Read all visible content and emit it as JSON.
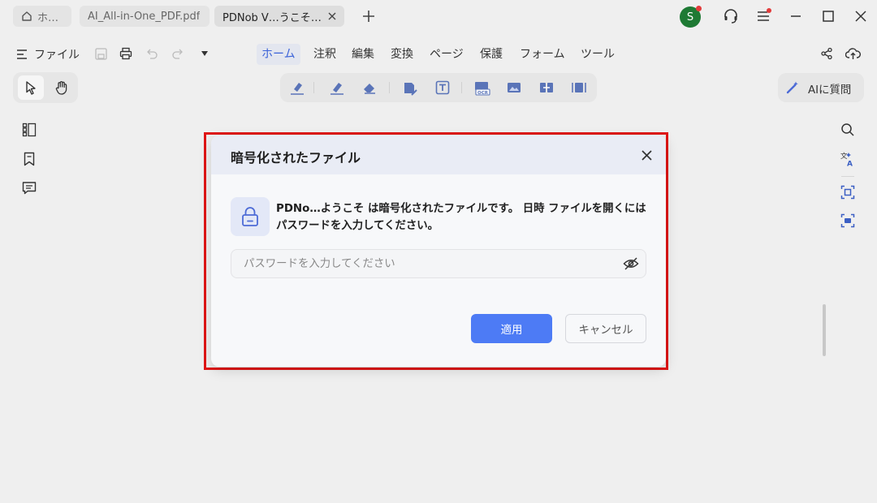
{
  "tabs": [
    {
      "label": "ホーム",
      "icon": "home-icon"
    },
    {
      "label": "AI_All-in-One_PDF.pdf"
    },
    {
      "label": "PDNob V…うこそ.pdf",
      "active": true
    }
  ],
  "new_tab_icon": "plus-icon",
  "window": {
    "avatar_letter": "S",
    "avatar_color": "#1e7a34",
    "notify_color": "#e23b3b"
  },
  "menu": {
    "file_label": "ファイル",
    "items": [
      "ホーム",
      "注釈",
      "編集",
      "変換",
      "ページ",
      "保護",
      "フォーム",
      "ツール"
    ],
    "active_index": 0
  },
  "toolbar": {
    "ai_label": "AIに質問"
  },
  "dialog": {
    "title": "暗号化されたファイル",
    "message": "PDNo…ようこそ は暗号化されたファイルです。 日時 ファイルを開くにはパスワードを入力してください。",
    "password_value": "",
    "password_placeholder": "パスワードを入力してください",
    "apply_label": "適用",
    "cancel_label": "キャンセル",
    "accent_color": "#4d7bf5",
    "highlight_color": "#e01515"
  }
}
